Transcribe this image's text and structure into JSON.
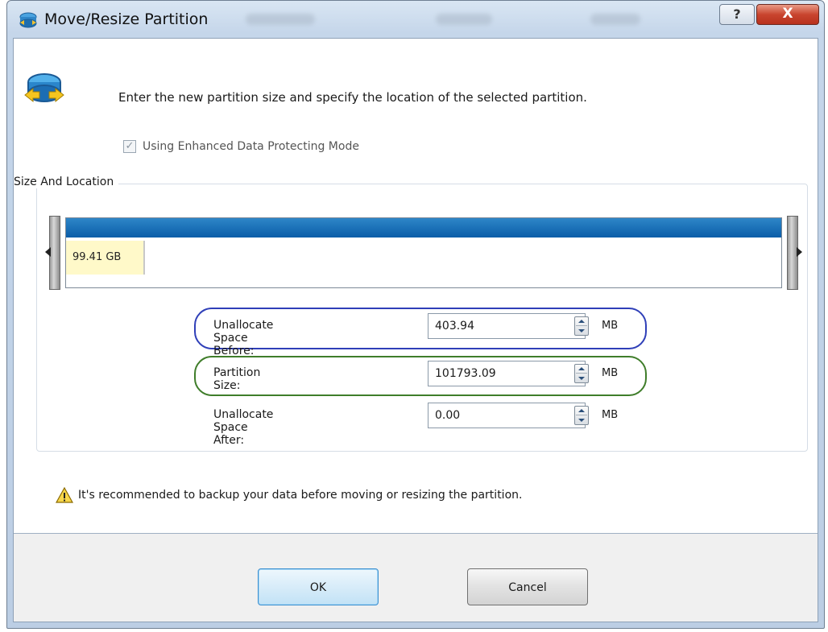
{
  "window": {
    "title": "Move/Resize Partition",
    "help_label": "?",
    "close_label": "X"
  },
  "header": {
    "instruction": "Enter the new partition size and specify the location of the selected partition."
  },
  "options": {
    "enhanced_mode_label": "Using Enhanced Data Protecting Mode",
    "enhanced_mode_checked": true
  },
  "size_location": {
    "group_label": "Size And Location",
    "partition_tag": "99.41 GB",
    "fields": [
      {
        "label": "Unallocate Space Before:",
        "value": "403.94",
        "unit": "MB",
        "highlight": "#2f3fb8"
      },
      {
        "label": "Partition Size:",
        "value": "101793.09",
        "unit": "MB",
        "highlight": "#3f7d2a"
      },
      {
        "label": "Unallocate Space After:",
        "value": "0.00",
        "unit": "MB"
      }
    ]
  },
  "warning": {
    "text": "It's recommended to backup your data before moving or resizing the partition."
  },
  "buttons": {
    "ok_label": "OK",
    "cancel_label": "Cancel"
  },
  "colors": {
    "partition_bar": "#0a5da8",
    "partition_tag_bg": "#fff9c9"
  }
}
